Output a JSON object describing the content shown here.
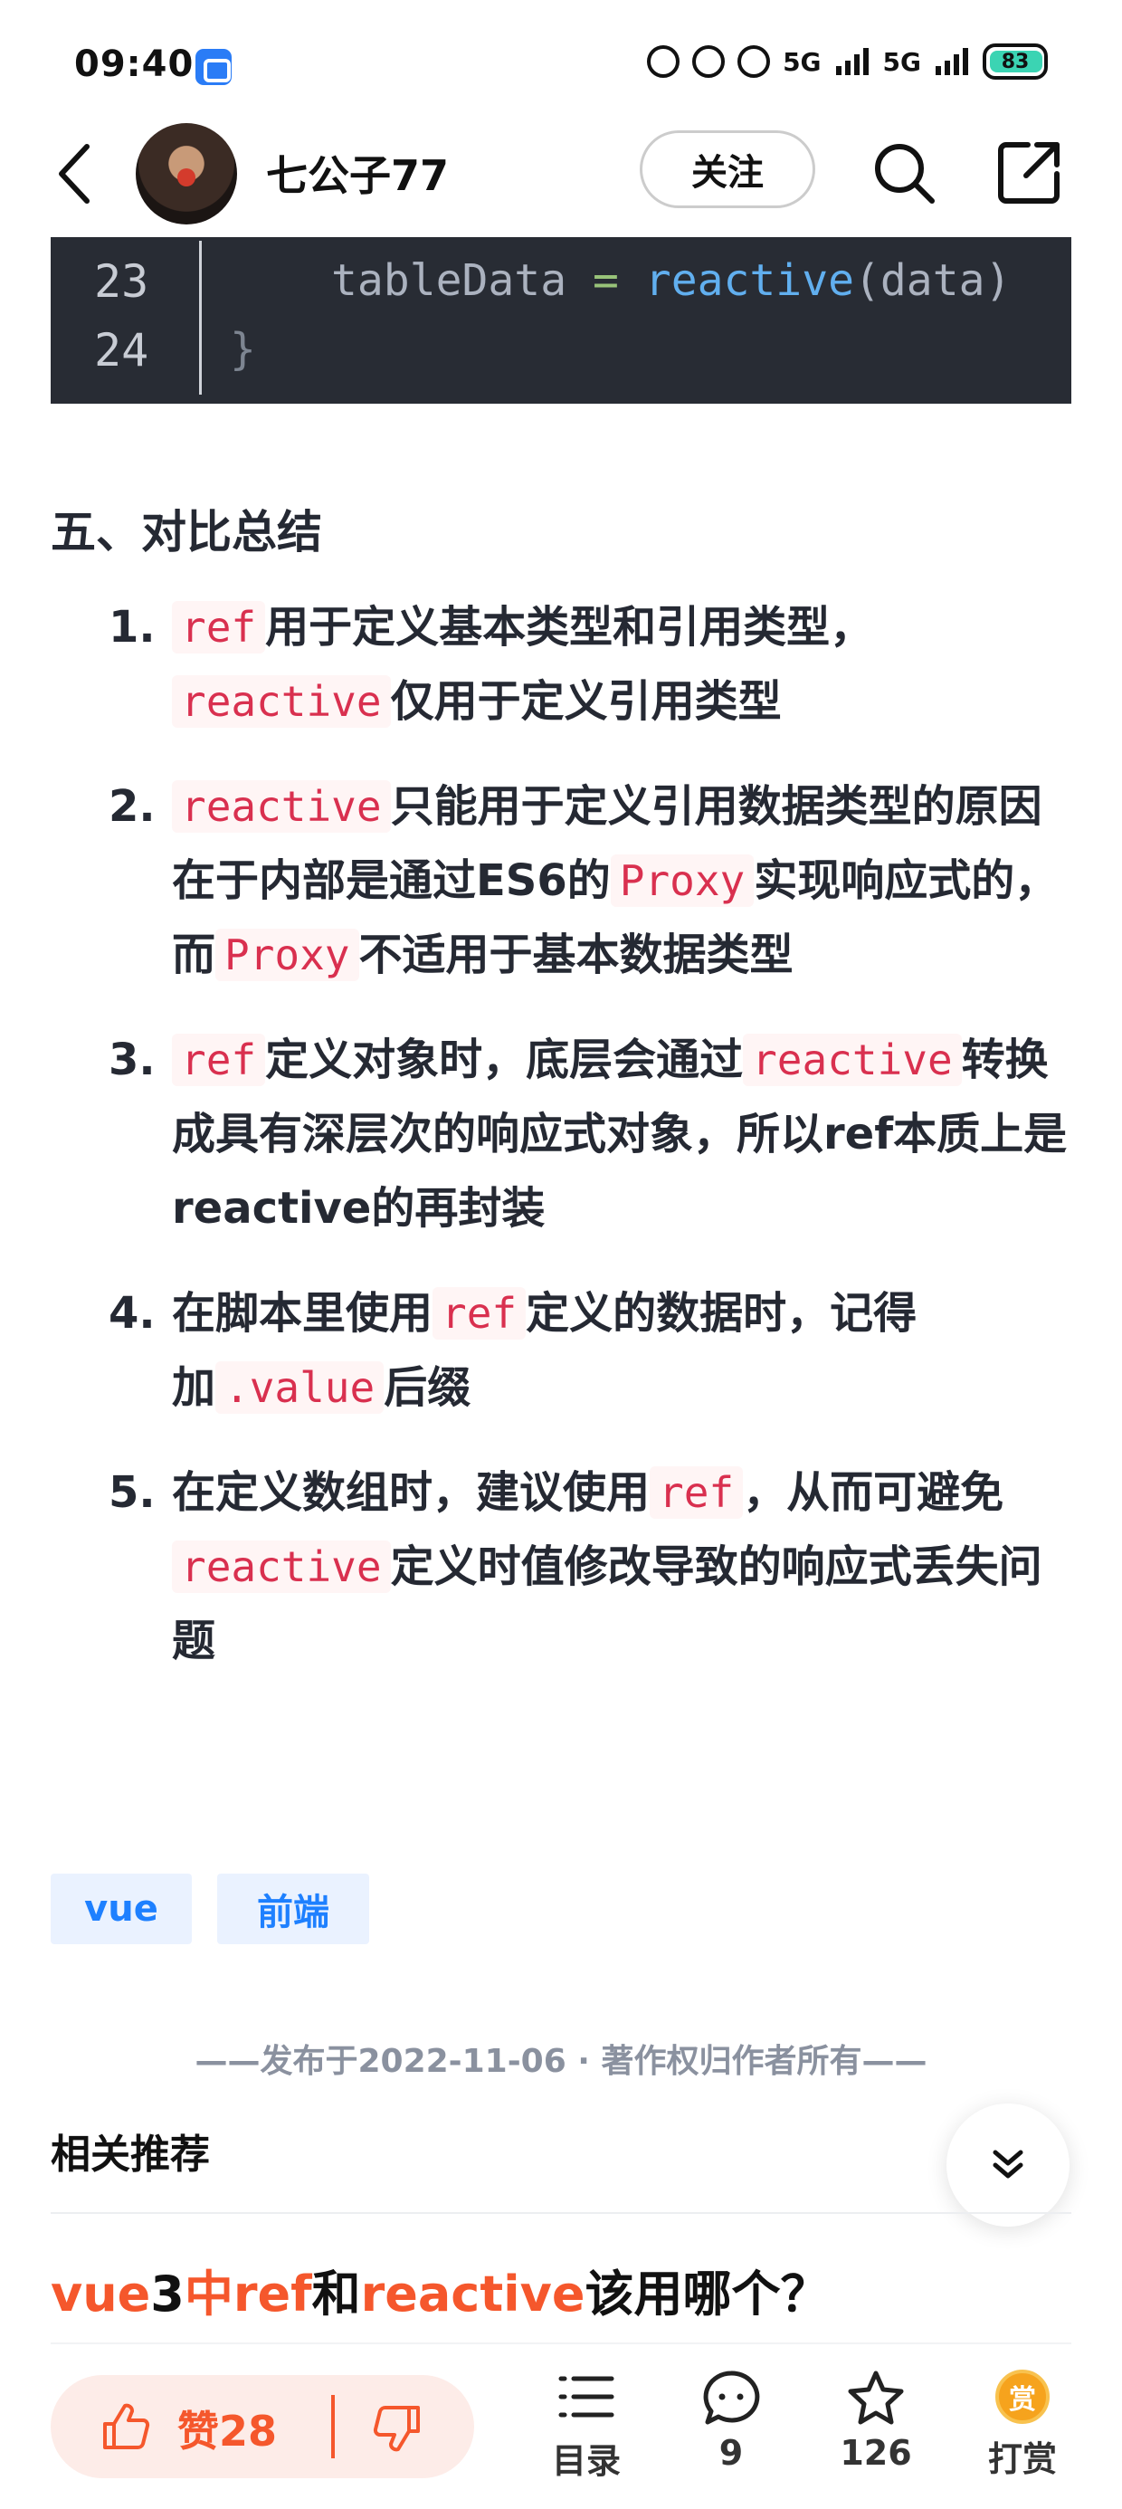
{
  "status": {
    "time": "09:40",
    "signal_a": "5G",
    "signal_b": "5G",
    "battery": "83"
  },
  "header": {
    "author": "七公子77",
    "follow_label": "关注"
  },
  "code": {
    "lines": [
      {
        "number": "23",
        "pre": "tableData ",
        "op": "=",
        "fn": "reactive",
        "open": "(",
        "arg": "data",
        "close": ")"
      },
      {
        "number": "24",
        "text": "}"
      }
    ]
  },
  "article": {
    "section_title": "五、对比总结",
    "items": [
      {
        "num": "1.",
        "parts": [
          [
            "c",
            "ref"
          ],
          [
            "t",
            "用于定义基本类型和引用类型，"
          ],
          [
            "c",
            "reactive"
          ],
          [
            "t",
            "仅用于定义引用类型"
          ]
        ]
      },
      {
        "num": "2.",
        "parts": [
          [
            "c",
            "reactive"
          ],
          [
            "t",
            "只能用于定义引用数据类型的原因在于内部是通过ES6的"
          ],
          [
            "c",
            "Proxy"
          ],
          [
            "t",
            "实现响应式的，而"
          ],
          [
            "c",
            "Proxy"
          ],
          [
            "t",
            "不适用于基本数据类型"
          ]
        ]
      },
      {
        "num": "3.",
        "parts": [
          [
            "c",
            "ref"
          ],
          [
            "t",
            "定义对象时，底层会通过"
          ],
          [
            "c",
            "reactive"
          ],
          [
            "t",
            "转换成具有深层次的响应式对象，所以ref本质上是reactive的再封装"
          ]
        ]
      },
      {
        "num": "4.",
        "parts": [
          [
            "t",
            "在脚本里使用"
          ],
          [
            "c",
            "ref"
          ],
          [
            "t",
            "定义的数据时，记得加"
          ],
          [
            "c",
            ".value"
          ],
          [
            "t",
            "后缀"
          ]
        ]
      },
      {
        "num": "5.",
        "parts": [
          [
            "t",
            "在定义数组时，建议使用"
          ],
          [
            "c",
            "ref"
          ],
          [
            "t",
            "，从而可避免"
          ],
          [
            "c",
            "reactive"
          ],
          [
            "t",
            "定义时值修改导致的响应式丢失问题"
          ]
        ]
      }
    ]
  },
  "tags": [
    "vue",
    "前端"
  ],
  "publish_info": "——发布于2022-11-06 · 著作权归作者所有——",
  "related": {
    "title": "相关推荐",
    "link_parts": [
      [
        "h",
        "vue"
      ],
      [
        "n",
        "3"
      ],
      [
        "h",
        "中ref"
      ],
      [
        "n",
        "和"
      ],
      [
        "h",
        "reactive"
      ],
      [
        "n",
        "该用哪个？"
      ]
    ]
  },
  "bottom_bar": {
    "like_label": "赞28",
    "toc_label": "目录",
    "comment_count": "9",
    "favorite_count": "126",
    "reward_label": "打赏",
    "reward_glyph": "赏"
  },
  "colors": {
    "accent": "#f5572c",
    "link_blue": "#1e80ff",
    "code_bg": "#282c34",
    "inline_code": "#d9304f"
  }
}
